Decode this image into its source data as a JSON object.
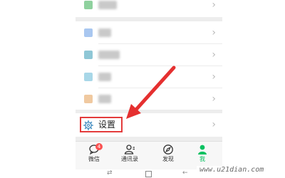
{
  "settings": {
    "label": "设置"
  },
  "tabs": [
    {
      "label": "微信",
      "icon": "chat-icon",
      "badge": "4"
    },
    {
      "label": "通讯录",
      "icon": "contacts-icon"
    },
    {
      "label": "发现",
      "icon": "discover-icon"
    },
    {
      "label": "我",
      "icon": "me-icon",
      "active": true
    }
  ],
  "list_rows": [
    {
      "icon_color": "#8fd19e"
    },
    {
      "icon_color": "#a9c7f0"
    },
    {
      "icon_color": "#8fc7d6"
    },
    {
      "icon_color": "#a8d7e8"
    },
    {
      "icon_color": "#f0c9a0"
    }
  ],
  "watermark": "www.u21dian.com",
  "colors": {
    "accent_green": "#07c160",
    "highlight_red": "#e33b3b",
    "badge_red": "#fa5151"
  }
}
